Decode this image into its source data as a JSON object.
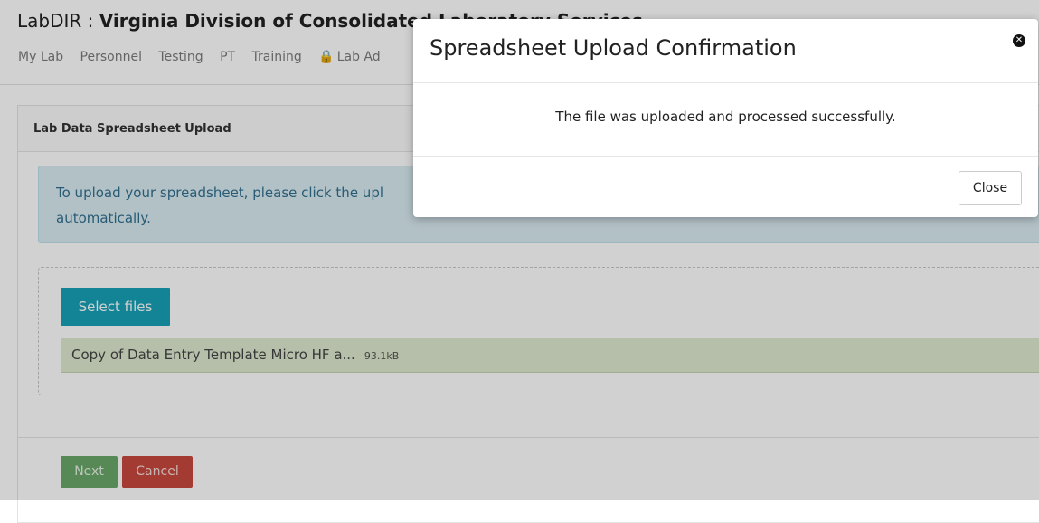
{
  "header": {
    "title_prefix": "LabDIR : ",
    "title_main": "Virginia Division of Consolidated Laboratory Services"
  },
  "nav": {
    "items": [
      "My Lab",
      "Personnel",
      "Testing",
      "PT",
      "Training",
      "Lab Ad"
    ]
  },
  "panel": {
    "title": "Lab Data Spreadsheet Upload",
    "info_line1": "To upload your spreadsheet, please click the upl",
    "info_line2": "automatically."
  },
  "upload": {
    "select_label": "Select files",
    "file_name": "Copy of Data Entry Template Micro HF a...",
    "file_size": "93.1kB"
  },
  "actions": {
    "next_label": "Next",
    "cancel_label": "Cancel"
  },
  "modal": {
    "title": "Spreadsheet Upload Confirmation",
    "message": "The file was uploaded and processed successfully.",
    "close_label": "Close",
    "close_icon": "close-circle-icon"
  },
  "colors": {
    "info_bg": "#d9ecf2",
    "select_button": "#17a2b8",
    "file_row_bg": "#dfe9cf",
    "next_button": "#6aa86a",
    "cancel_button": "#c9483f"
  }
}
